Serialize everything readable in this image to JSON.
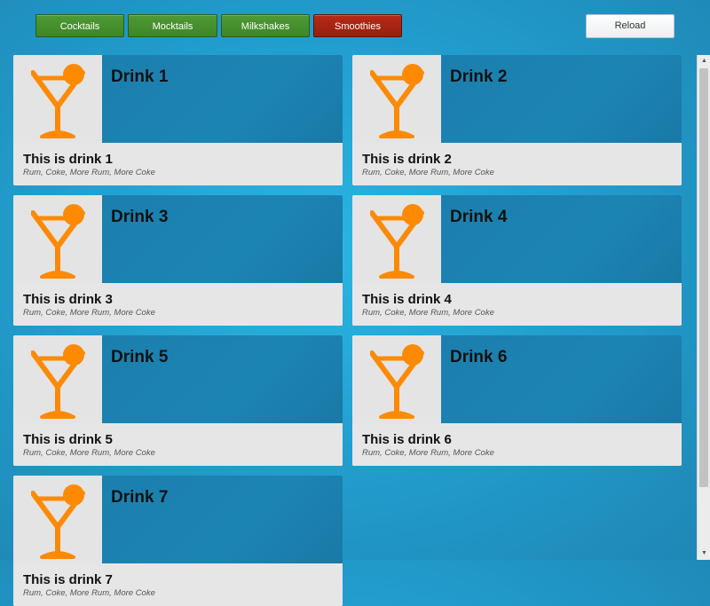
{
  "categories": [
    {
      "label": "Cocktails",
      "active": false
    },
    {
      "label": "Mocktails",
      "active": false
    },
    {
      "label": "Milkshakes",
      "active": false
    },
    {
      "label": "Smoothies",
      "active": true
    }
  ],
  "reload_label": "Reload",
  "drinks": [
    {
      "title": "Drink 1",
      "subtitle": "This is drink 1",
      "ingredients": "Rum, Coke, More Rum, More Coke",
      "icon": "martini-glass-icon"
    },
    {
      "title": "Drink 2",
      "subtitle": "This is drink 2",
      "ingredients": "Rum, Coke, More Rum, More Coke",
      "icon": "martini-glass-icon"
    },
    {
      "title": "Drink 3",
      "subtitle": "This is drink 3",
      "ingredients": "Rum, Coke, More Rum, More Coke",
      "icon": "martini-glass-icon"
    },
    {
      "title": "Drink 4",
      "subtitle": "This is drink 4",
      "ingredients": "Rum, Coke, More Rum, More Coke",
      "icon": "martini-glass-icon"
    },
    {
      "title": "Drink 5",
      "subtitle": "This is drink 5",
      "ingredients": "Rum, Coke, More Rum, More Coke",
      "icon": "martini-glass-icon"
    },
    {
      "title": "Drink 6",
      "subtitle": "This is drink 6",
      "ingredients": "Rum, Coke, More Rum, More Coke",
      "icon": "martini-glass-icon"
    },
    {
      "title": "Drink 7",
      "subtitle": "This is drink 7",
      "ingredients": "Rum, Coke, More Rum, More Coke",
      "icon": "martini-glass-icon"
    }
  ],
  "colors": {
    "accent_icon": "#ff8a00",
    "category_green": "#4a9530",
    "category_active_red": "#a8240f",
    "tile_header_blue": "#1b80ae"
  }
}
